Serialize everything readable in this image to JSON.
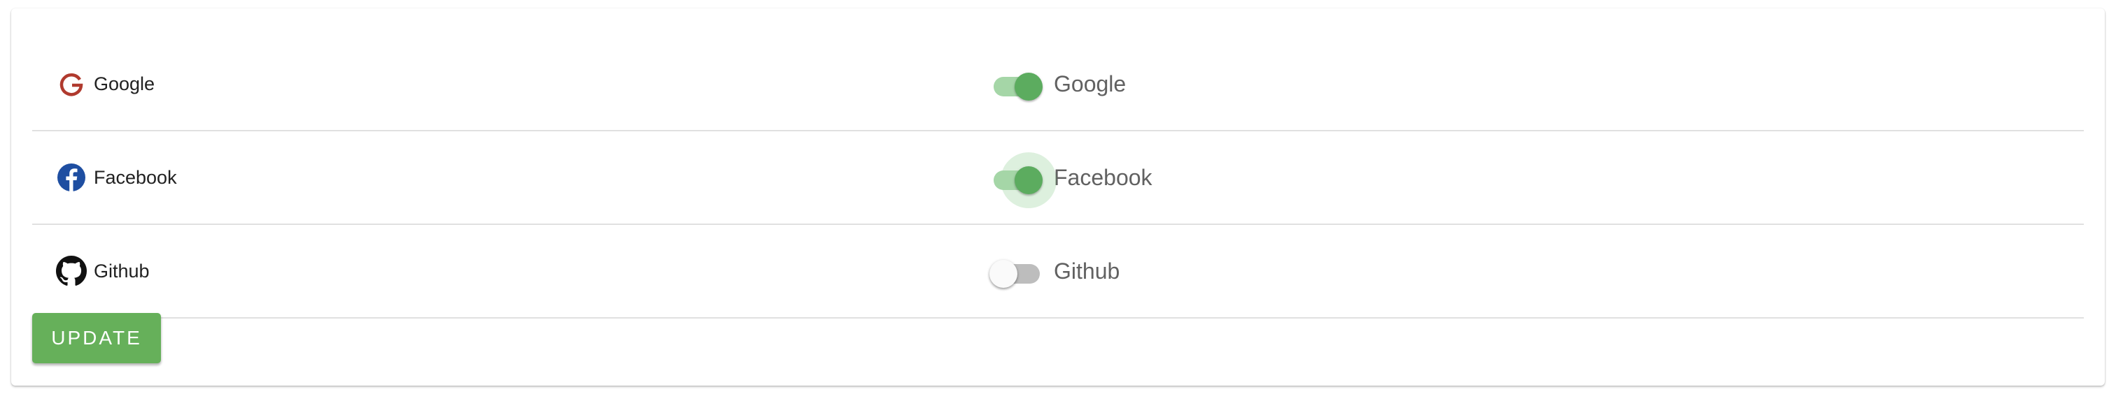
{
  "providers": [
    {
      "name": "Google",
      "toggle_label": "Google",
      "enabled": true,
      "icon": "google-icon"
    },
    {
      "name": "Facebook",
      "toggle_label": "Facebook",
      "enabled": true,
      "icon": "facebook-icon"
    },
    {
      "name": "Github",
      "toggle_label": "Github",
      "enabled": false,
      "icon": "github-icon"
    }
  ],
  "update_label": "UPDATE",
  "colors": {
    "accent": "#66b05a",
    "track_on": "#a5d6a7",
    "track_off": "#bdbdbd",
    "google": "#b03a2e",
    "facebook": "#1e4ea1"
  }
}
